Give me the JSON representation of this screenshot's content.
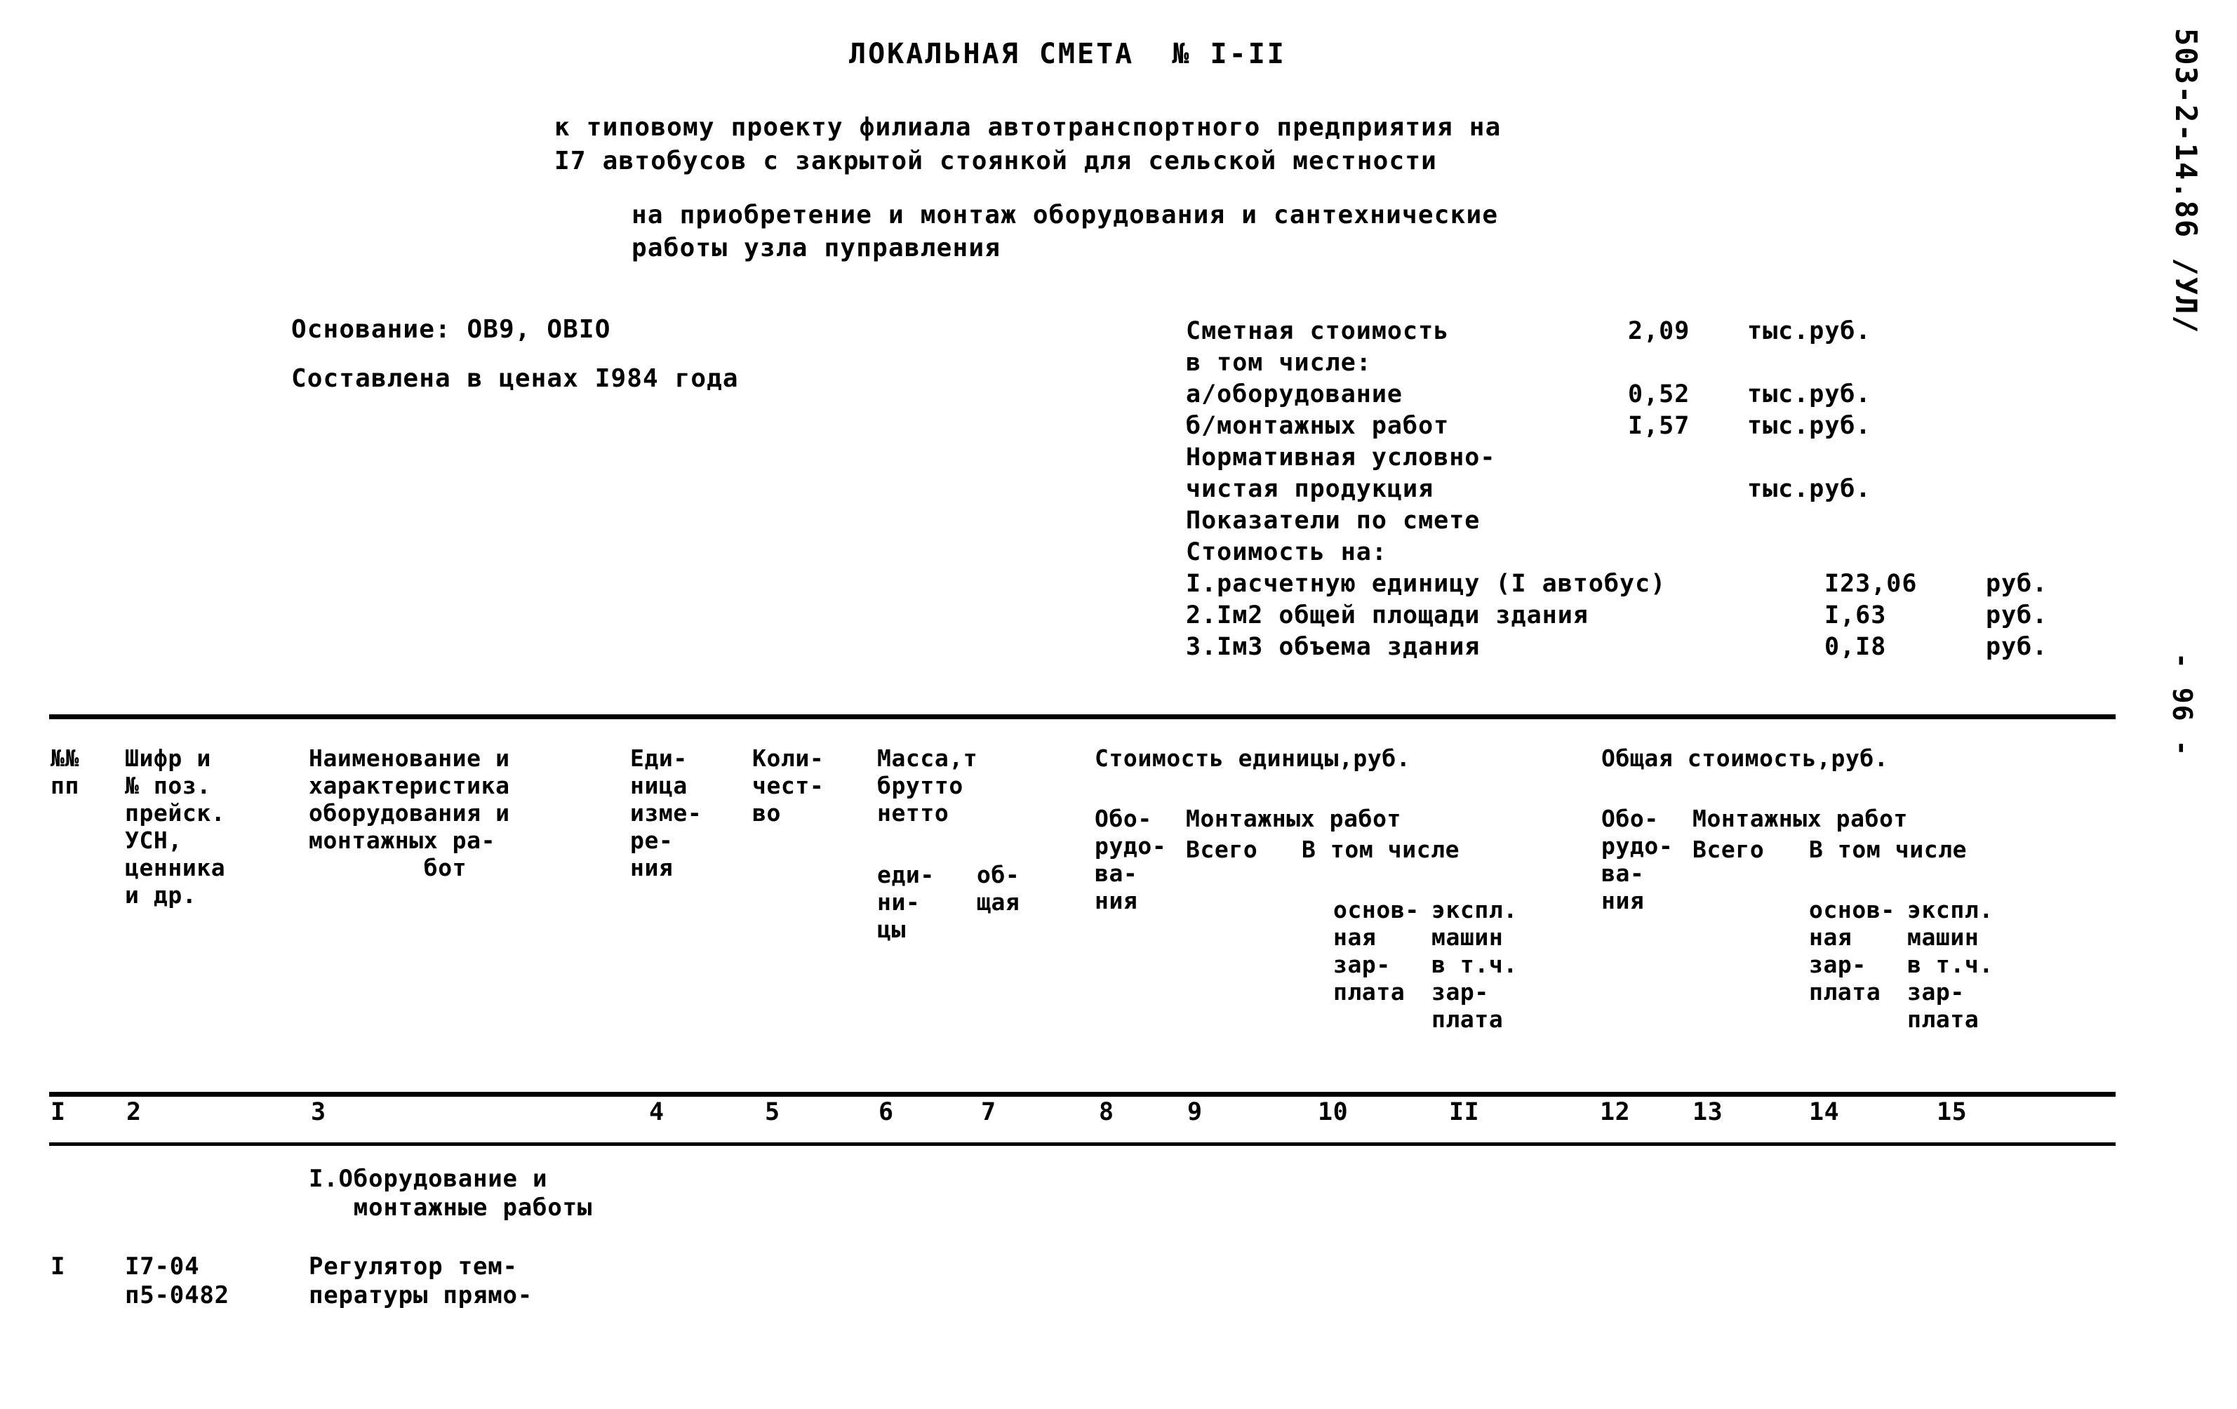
{
  "document": {
    "title": "ЛОКАЛЬНАЯ СМЕТА  № I-II",
    "subtitle_line1": "к типовому проекту филиала автотранспортного предприятия на",
    "subtitle_line2": "I7 автобусов с закрытой стоянкой для сельской местности",
    "subtitle_line3": "на приобретение и монтаж оборудования и сантехнические",
    "subtitle_line4": "работы узла пуправления",
    "margin_code": "503-2-14.86 /УЛ/",
    "page_marker": "- 96 -"
  },
  "basis": {
    "line1": "Основание: ОВ9, ОВIO",
    "line2": "Составлена в ценах I984 года"
  },
  "summary": {
    "rows": [
      {
        "label": "Сметная стоимость",
        "value": "2,09",
        "unit": "тыс.руб."
      },
      {
        "label": "в том числе:",
        "value": "",
        "unit": ""
      },
      {
        "label": "а/оборудование",
        "value": "0,52",
        "unit": "тыс.руб."
      },
      {
        "label": "б/монтажных работ",
        "value": "I,57",
        "unit": "тыс.руб."
      },
      {
        "label": "Нормативная условно-",
        "value": "",
        "unit": ""
      },
      {
        "label": "чистая продукция",
        "value": "",
        "unit": "тыс.руб."
      },
      {
        "label": "Показатели по смете",
        "value": "",
        "unit": ""
      },
      {
        "label": "Стоимость на:",
        "value": "",
        "unit": ""
      }
    ],
    "indicators": [
      {
        "label": "I.расчетную единицу (I автобус)",
        "value": "I23,06",
        "unit": "руб."
      },
      {
        "label": "2.Iм2 общей площади здания",
        "value": "I,63",
        "unit": "руб."
      },
      {
        "label": "3.Iм3 объема здания",
        "value": "0,I8",
        "unit": "руб."
      }
    ]
  },
  "table": {
    "headers": {
      "c1": "№№\nпп",
      "c2": "Шифр и\n№ поз.\nпрейск.\nУСН,\nценника\nи др.",
      "c3": "Наименование и\nхарактеристика\nоборудования и\nмонтажных ра-\n        бот",
      "c4": "Еди-\nница\nизме-\nре-\nния",
      "c5": "Коли-\nчест-\nво",
      "c6": "Масса,т\nбрутто\nнетто",
      "c6b": "еди-\nни-\nцы",
      "c7": "об-\nщая",
      "g1_title": "Стоимость единицы,руб.",
      "g1_c8": "Обо-\nрудо-\nва-\nния",
      "g1_mw": "Монтажных работ",
      "g1_c9": "Всего",
      "g1_vtch": "В том числе",
      "g1_c10": "основ-\nная\nзар-\nплата",
      "g1_c11": "экспл.\nмашин\nв т.ч.\nзар-\nплата",
      "g2_title": "Общая стоимость,руб.",
      "g2_c12": "Обо-\nрудо-\nва-\nния",
      "g2_mw": "Монтажных работ",
      "g2_c13": "Всего",
      "g2_vtch": "В том числе",
      "g2_c14": "основ-\nная\nзар-\nплата",
      "g2_c15": "экспл.\nмашин\nв т.ч.\nзар-\nплата"
    },
    "column_numbers": [
      "I",
      "2",
      "3",
      "4",
      "5",
      "6",
      "7",
      "8",
      "9",
      "10",
      "II",
      "12",
      "13",
      "14",
      "15"
    ],
    "body": {
      "section_title": "I.Оборудование и\n   монтажные работы",
      "row1": {
        "num": "I",
        "code": "I7-04\nп5-0482",
        "name": "Регулятор тем-\nпературы прямо-"
      }
    }
  },
  "colors": {
    "ink": "#000000",
    "paper": "#ffffff"
  }
}
